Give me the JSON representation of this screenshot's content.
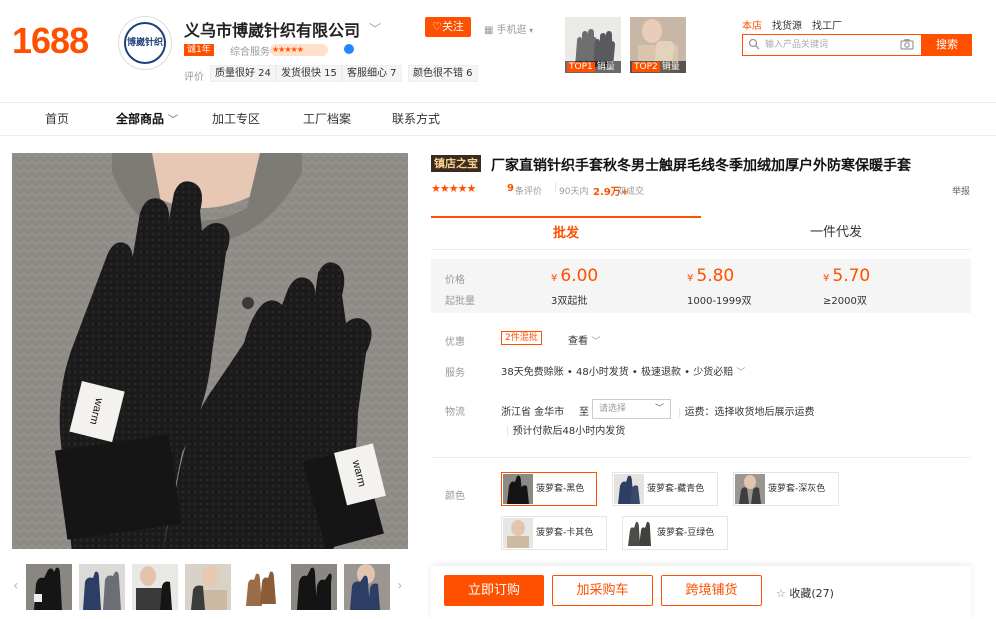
{
  "header": {
    "logo": "1688",
    "shop_logo_text": "博崴针织",
    "shop_name": "义乌市博崴针织有限公司",
    "year_badge": "诚1年",
    "overall_label": "综合服务",
    "overall_stars": "★★★★★",
    "eval_label": "评价",
    "tags": [
      "质量很好 24",
      "发货很快 15",
      "客服细心 7",
      "颜色很不错 6"
    ],
    "follow": "关注",
    "mobile": "手机逛",
    "top1": {
      "rank": "TOP1",
      "label": "销量"
    },
    "top2": {
      "rank": "TOP2",
      "label": "销量"
    },
    "scope": [
      "本店",
      "找货源",
      "找工厂"
    ],
    "search_placeholder": "输入产品关键词",
    "search_button": "搜索"
  },
  "nav": [
    "首页",
    "全部商品",
    "加工专区",
    "工厂档案",
    "联系方式"
  ],
  "product": {
    "treasure_tag": "镇店之宝",
    "title": "厂家直销针织手套秋冬男士触屏毛线冬季加绒加厚户外防寒保暖手套",
    "stars": "★★★★★",
    "reviews_num": "9",
    "reviews_label": "条评价",
    "days": "90天内",
    "deals_num": "2.9万+",
    "deals_label": "双成交",
    "report": "举报",
    "glove_tag": "warm"
  },
  "tabs": {
    "wholesale": "批发",
    "dropship": "一件代发"
  },
  "pricing": {
    "price_label": "价格",
    "qty_label": "起批量",
    "currency": "¥",
    "tiers": [
      {
        "price": "6.00",
        "qty": "3双起批"
      },
      {
        "price": "5.80",
        "qty": "1000-1999双"
      },
      {
        "price": "5.70",
        "qty": "≥2000双"
      }
    ]
  },
  "promo": {
    "label": "优惠",
    "tag": "2件混批",
    "view": "查看"
  },
  "service": {
    "label": "服务",
    "text": "38天免费赊账 • 48小时发货 • 极速退款 • 少货必赔"
  },
  "logistics": {
    "label": "物流",
    "from": "浙江省 金华市",
    "to_label": "至",
    "select_placeholder": "请选择",
    "freight": "运费：选择收货地后展示运费",
    "eta": "预计付款后48小时内发货"
  },
  "colors": {
    "label": "颜色",
    "options": [
      "菠萝套-黑色",
      "菠萝套-藏青色",
      "菠萝套-深灰色",
      "菠萝套-卡其色",
      "菠萝套-豆绿色"
    ]
  },
  "actions": {
    "buy_now": "立即订购",
    "add_cart": "加采购车",
    "cross_border": "跨境铺货",
    "favorite": "收藏(27)"
  },
  "palette": {
    "accent": "#ff5000",
    "sweater": "#8f8b87",
    "glove": "#141414"
  }
}
